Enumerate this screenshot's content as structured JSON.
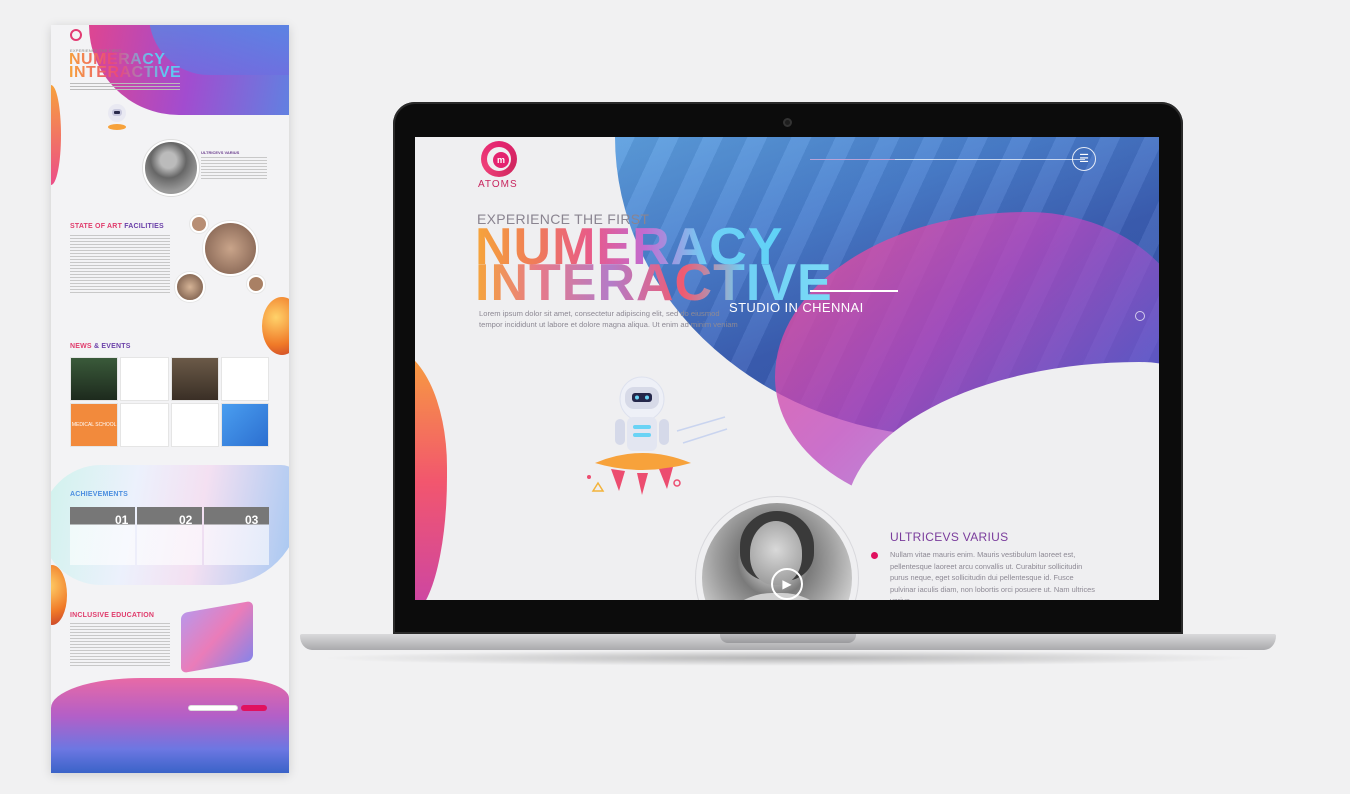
{
  "preview": {
    "pretitle": "EXPERIENCE THE FIRST",
    "title_line1": "NUMERACY",
    "title_line2": "INTERACTIVE",
    "ultricevs_heading": "ULTRICEVS VARIUS",
    "facilities_a": "STATE OF ART ",
    "facilities_b": "FACILITIES",
    "news_a": "NEWS ",
    "news_b": "& EVENTS",
    "achievements": "ACHIEVEMENTS",
    "inclusive": "INCLUSIVE EDUCATION",
    "news_tile_label": "MEDICAL SCHOOL",
    "ach_numbers": [
      "01",
      "02",
      "03"
    ]
  },
  "site": {
    "logo_text": "ATOMS",
    "logo_mark": "m",
    "pretitle": "EXPERIENCE THE FIRST",
    "title_line1": "NUMERACY",
    "title_line2": "INTERACTIVE",
    "subtitle": "STUDIO IN CHENNAI",
    "intro": "Lorem ipsum dolor sit amet, consectetur adipiscing elit, sed do eiusmod tempor incididunt ut labore et dolore magna aliqua. Ut enim ad minim veniam",
    "section_title": "ULTRICEVS VARIUS",
    "section_body": "Nullam vitae mauris enim. Mauris vestibulum laoreet est, pellentesque laoreet arcu convallis ut. Curabitur sollicitudin purus neque, eget sollicitudin dui pellentesque id. Fusce pulvinar iaculis diam, non lobortis orci posuere ut. Nam ultrices varius",
    "menu_icon": "menu-icon",
    "play_icon": "play-icon"
  },
  "colors": {
    "brand_pink": "#e4236f",
    "purple": "#7a3c9c",
    "gradient_orange": "#f6a53a",
    "gradient_cyan": "#5fd2f7",
    "hero_blue": "#4a7fce"
  }
}
